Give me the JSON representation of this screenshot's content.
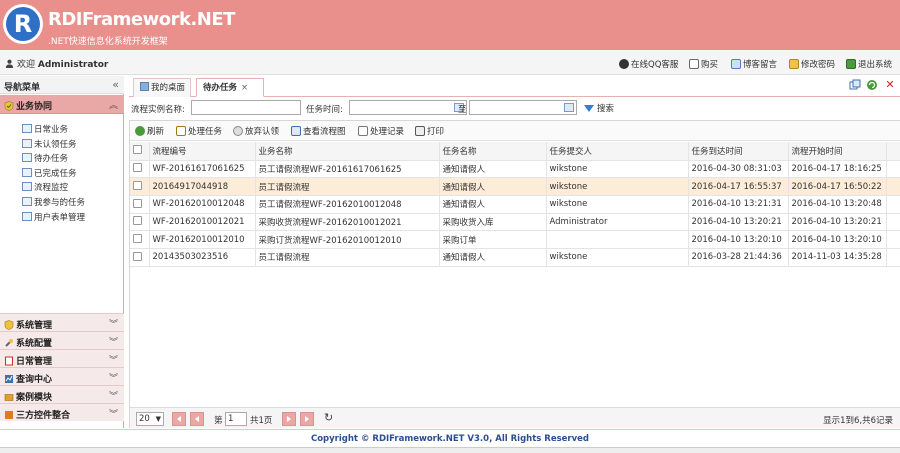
{
  "header": {
    "logo_letter": "R",
    "title": "RDIFramework.NET",
    "subtitle": ".NET快速信息化系统开发框架",
    "banner_color": "#e98f8c"
  },
  "topbar": {
    "welcome_prefix": "欢迎",
    "user": "Administrator",
    "links": [
      "在线QQ客服",
      "购买",
      "博客留言",
      "修改密码",
      "退出系统"
    ]
  },
  "nav": {
    "header": "导航菜单",
    "active_group": "业务协同",
    "items": [
      "日常业务",
      "未认领任务",
      "待办任务",
      "已完成任务",
      "流程监控",
      "我参与的任务",
      "用户表单管理"
    ],
    "groups": [
      "系统管理",
      "系统配置",
      "日常管理",
      "查询中心",
      "案例模块",
      "三方控件整合"
    ]
  },
  "tabs": [
    "我的桌面",
    "待办任务"
  ],
  "search": {
    "instance_label": "流程实例名称:",
    "time_label": "任务时间:",
    "to_label": "至",
    "button": "搜索"
  },
  "toolbar": [
    "刷新",
    "处理任务",
    "放弃认领",
    "查看流程图",
    "处理记录",
    "打印"
  ],
  "table": {
    "columns": [
      "流程编号",
      "业务名称",
      "任务名称",
      "任务提交人",
      "任务到达时间",
      "流程开始时间"
    ],
    "rows": [
      [
        "WF-20161617061625",
        "员工请假流程WF-20161617061625",
        "通知请假人",
        "wikstone",
        "2016-04-30 08:31:03",
        "2016-04-17 18:16:25"
      ],
      [
        "20164917044918",
        "员工请假流程",
        "通知请假人",
        "wikstone",
        "2016-04-17 16:55:37",
        "2016-04-17 16:50:22"
      ],
      [
        "WF-20162010012048",
        "员工请假流程WF-20162010012048",
        "通知请假人",
        "wikstone",
        "2016-04-10 13:21:31",
        "2016-04-10 13:20:48"
      ],
      [
        "WF-20162010012021",
        "采购收货流程WF-20162010012021",
        "采购收货入库",
        "Administrator",
        "2016-04-10 13:20:21",
        "2016-04-10 13:20:21"
      ],
      [
        "WF-20162010012010",
        "采购订货流程WF-20162010012010",
        "采购订单",
        "",
        "2016-04-10 13:20:10",
        "2016-04-10 13:20:10"
      ],
      [
        "20143503023516",
        "员工请假流程",
        "通知请假人",
        "wikstone",
        "2016-03-28 21:44:36",
        "2014-11-03 14:35:28"
      ]
    ]
  },
  "pager": {
    "page_size": "20",
    "page_label": "第",
    "page_value": "1",
    "page_total": "共1页",
    "info": "显示1到6,共6记录"
  },
  "footer": "Copyright © RDIFramework.NET V3.0, All Rights Reserved"
}
